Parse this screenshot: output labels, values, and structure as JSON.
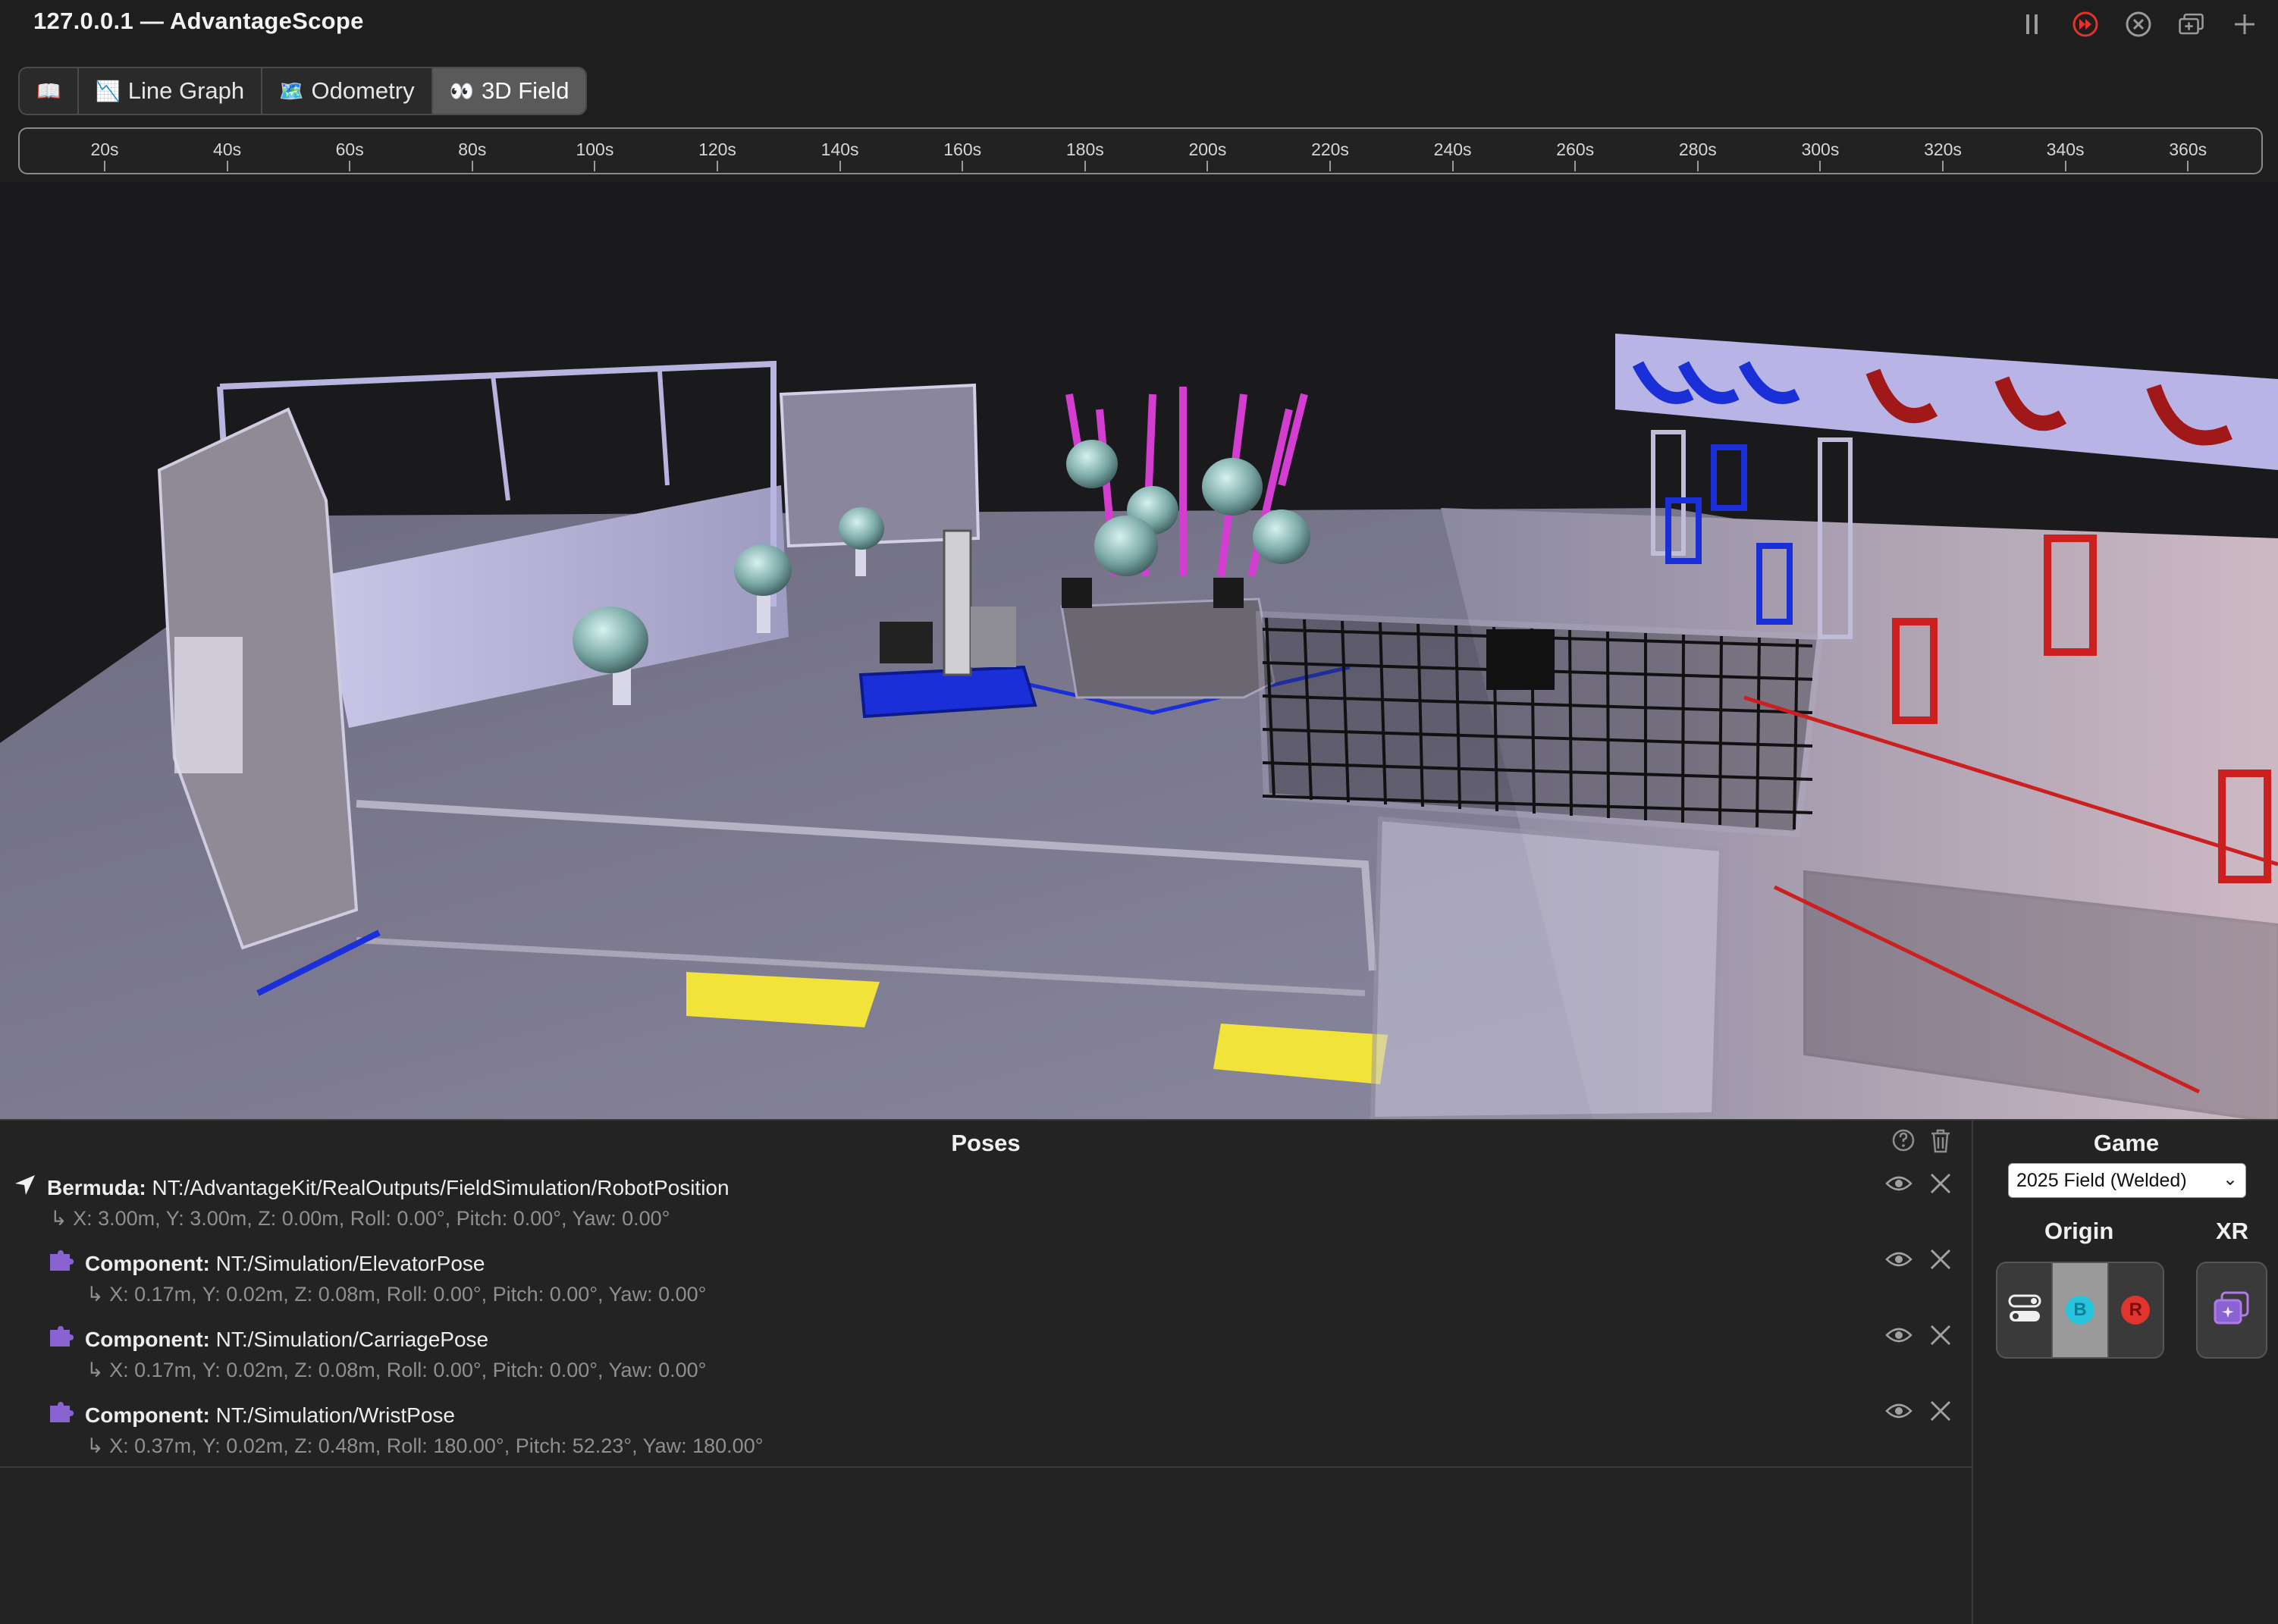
{
  "window": {
    "title": "127.0.0.1 — AdvantageScope"
  },
  "window_controls": [
    {
      "name": "pause-icon"
    },
    {
      "name": "live-icon",
      "color": "#e0342c"
    },
    {
      "name": "close-circle-icon"
    },
    {
      "name": "new-window-icon"
    },
    {
      "name": "add-tab-icon"
    }
  ],
  "tabs": [
    {
      "icon": "📖",
      "label": ""
    },
    {
      "icon": "📉",
      "label": "Line Graph"
    },
    {
      "icon": "🗺️",
      "label": "Odometry"
    },
    {
      "icon": "👀",
      "label": "3D Field",
      "active": true
    }
  ],
  "timeline": {
    "ticks": [
      "20s",
      "40s",
      "60s",
      "80s",
      "100s",
      "120s",
      "140s",
      "160s",
      "180s",
      "200s",
      "220s",
      "240s",
      "260s",
      "280s",
      "300s",
      "320s",
      "340s",
      "360s"
    ]
  },
  "poses": {
    "title": "Poses",
    "rows": [
      {
        "type": "Bermuda:",
        "key": "NT:/AdvantageKit/RealOutputs/FieldSimulation/RobotPosition",
        "value": "↳ X: 3.00m, Y: 3.00m, Z: 0.00m, Roll: 0.00°, Pitch: 0.00°, Yaw: 0.00°",
        "icon": "location-arrow-icon"
      },
      {
        "type": "Component:",
        "key": "NT:/Simulation/ElevatorPose",
        "value": "↳ X: 0.17m, Y: 0.02m, Z: 0.08m, Roll: 0.00°, Pitch: 0.00°, Yaw: 0.00°",
        "icon": "puzzle-piece-icon"
      },
      {
        "type": "Component:",
        "key": "NT:/Simulation/CarriagePose",
        "value": "↳ X: 0.17m, Y: 0.02m, Z: 0.08m, Roll: 0.00°, Pitch: 0.00°, Yaw: 0.00°",
        "icon": "puzzle-piece-icon"
      },
      {
        "type": "Component:",
        "key": "NT:/Simulation/WristPose",
        "value": "↳ X: 0.37m, Y: 0.02m, Z: 0.48m, Roll: 180.00°, Pitch: 52.23°, Yaw: 180.00°",
        "icon": "puzzle-piece-icon"
      }
    ]
  },
  "game": {
    "title": "Game",
    "selected": "2025 Field (Welded)",
    "origin_label": "Origin",
    "xr_label": "XR",
    "origin_options": [
      {
        "label": "",
        "icon": "toggle-icon"
      },
      {
        "label": "B",
        "color": "#27c4dd",
        "active": true
      },
      {
        "label": "R",
        "color": "#e0342c"
      }
    ]
  },
  "colors": {
    "accent_purple": "#8a63d2",
    "blue_alliance": "#1a2fd8",
    "red_alliance": "#cc1f1f"
  }
}
